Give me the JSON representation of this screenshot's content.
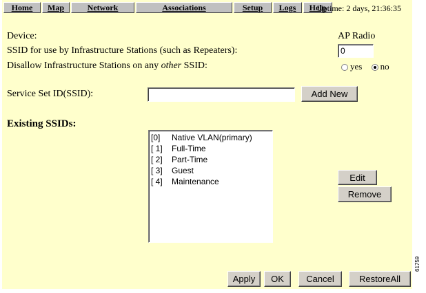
{
  "nav": {
    "items": [
      {
        "label": "Home",
        "w": 54
      },
      {
        "label": "Map",
        "w": 40
      },
      {
        "label": "Network",
        "w": 92
      },
      {
        "label": "Associations",
        "w": 140
      },
      {
        "label": "Setup",
        "w": 55
      },
      {
        "label": "Logs",
        "w": 42
      },
      {
        "label": "Help",
        "w": 42
      }
    ],
    "uptime": "Uptime: 2 days, 21:36:35"
  },
  "device": {
    "label": "Device:",
    "value": "AP Radio"
  },
  "infra_ssid": {
    "label": "SSID for use by Infrastructure Stations (such as Repeaters):",
    "value": "0"
  },
  "disallow": {
    "label_pre": "Disallow Infrastructure Stations on any ",
    "label_em": "other",
    "label_post": " SSID:",
    "yes": "yes",
    "no": "no",
    "selected": "no"
  },
  "ssid_field": {
    "label": "Service Set ID(SSID):",
    "value": "",
    "add_label": "Add New"
  },
  "existing": {
    "heading": "Existing SSIDs:",
    "items": [
      {
        "index": "[0]",
        "name": "Native VLAN(primary)"
      },
      {
        "index": "[ 1]",
        "name": "Full-Time"
      },
      {
        "index": "[ 2]",
        "name": "Part-Time"
      },
      {
        "index": "[ 3]",
        "name": "Guest"
      },
      {
        "index": "[ 4]",
        "name": "Maintenance"
      }
    ],
    "edit_label": "Edit",
    "remove_label": "Remove"
  },
  "footer": {
    "apply": "Apply",
    "ok": "OK",
    "cancel": "Cancel",
    "restore": "RestoreAll"
  },
  "side_code": "61759",
  "colors": {
    "panel": "#ffffcc",
    "button": "#d4d0c8"
  }
}
